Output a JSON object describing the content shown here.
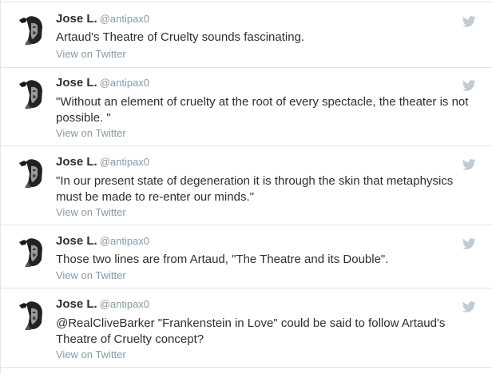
{
  "tweets": [
    {
      "name": "Jose L.",
      "handle": "@antipax0",
      "text": "Artaud's Theatre of Cruelty sounds fascinating.",
      "view_link": "View on Twitter"
    },
    {
      "name": "Jose L.",
      "handle": "@antipax0",
      "text": "\"Without an element of cruelty at the root of every spectacle, the theater is not possible. \"",
      "view_link": "View on Twitter"
    },
    {
      "name": "Jose L.",
      "handle": "@antipax0",
      "text": "\"In our present state of degeneration it is through the skin that metaphysics must be made to re-enter our minds.\"",
      "view_link": "View on Twitter"
    },
    {
      "name": "Jose L.",
      "handle": "@antipax0",
      "text": "Those two lines are from Artaud, \"The Theatre and its Double\".",
      "view_link": "View on Twitter"
    },
    {
      "name": "Jose L.",
      "handle": "@antipax0",
      "text": "@RealCliveBarker \"Frankenstein in Love\" could be said to follow Artaud's Theatre of Cruelty concept?",
      "view_link": "View on Twitter"
    }
  ],
  "icons": {
    "avatar": "avatar-portrait-icon",
    "bird": "twitter-bird-icon"
  },
  "colors": {
    "text": "#292f33",
    "muted": "#8899a6",
    "divider": "#e3e3e3",
    "bird": "#c2cbd2"
  }
}
